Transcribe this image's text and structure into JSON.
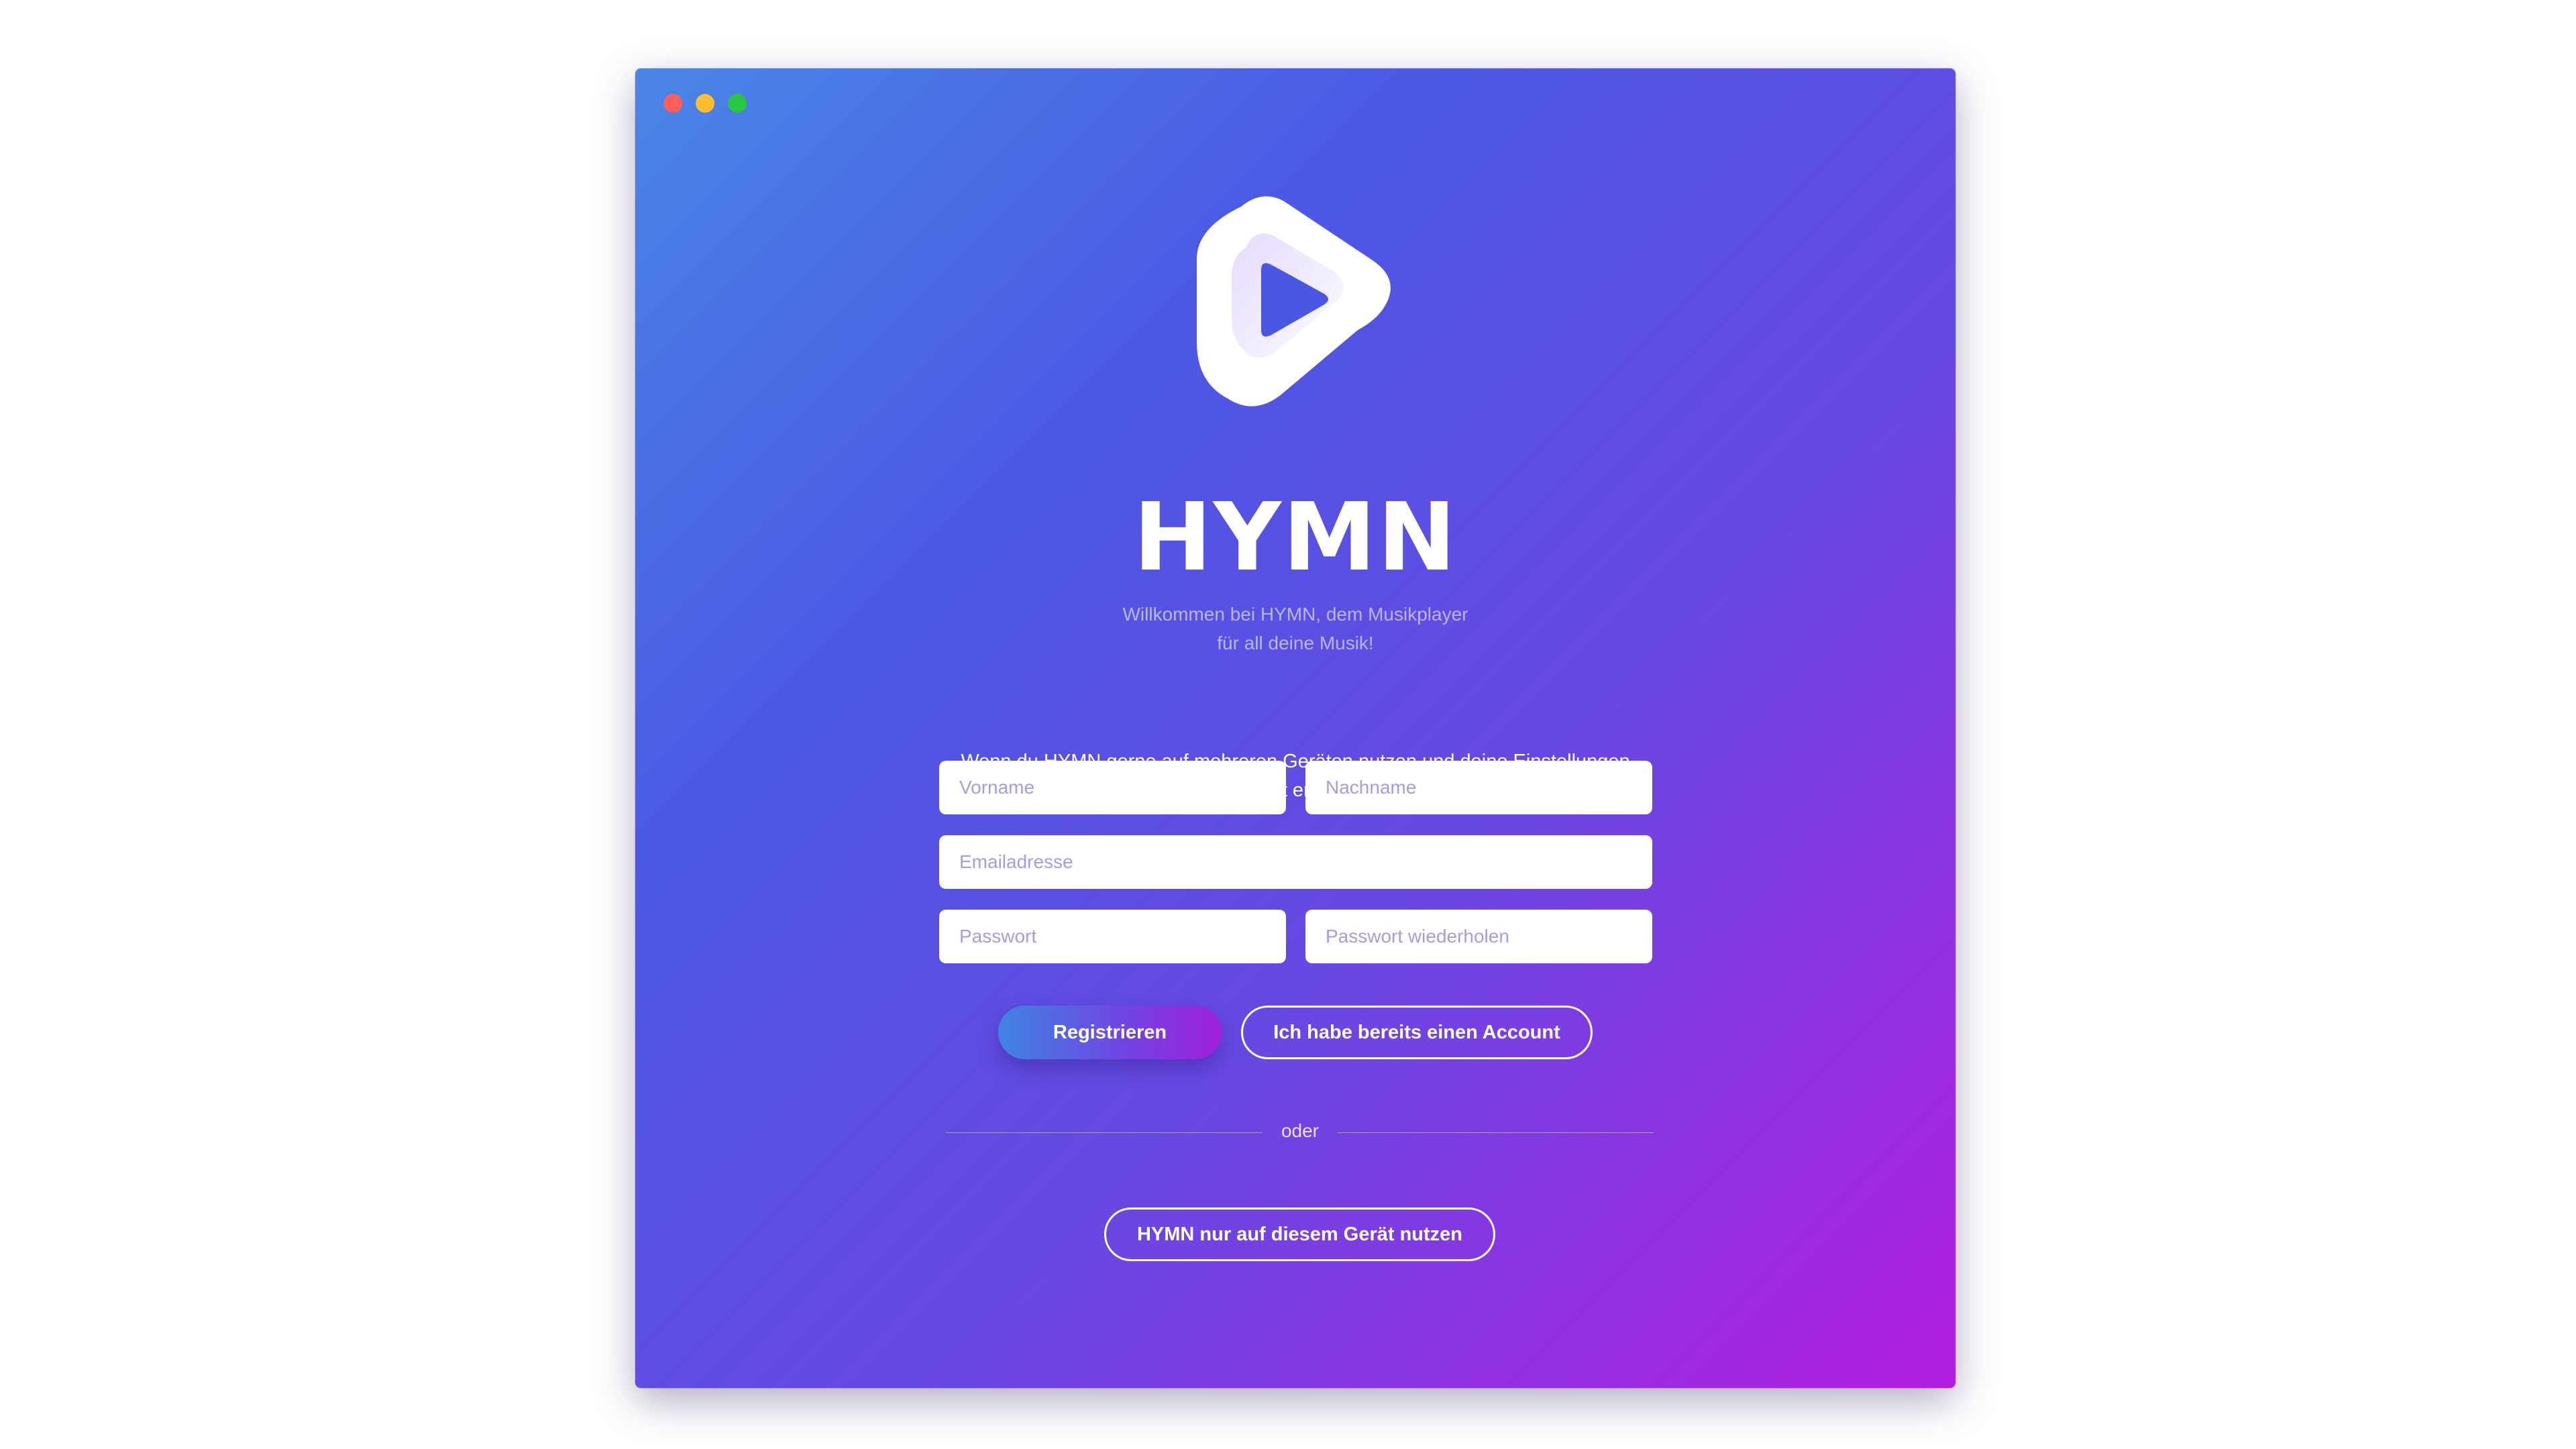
{
  "window": {
    "controls": [
      "close",
      "minimize",
      "zoom"
    ]
  },
  "brand": {
    "logo_icon": "play-triangle-icon",
    "name": "HYMN",
    "tagline_line1": "Willkommen bei HYMN, dem Musikplayer",
    "tagline_line2": "für all deine Musik!"
  },
  "intro": {
    "line1": "Wenn du HYMN gerne auf mehreren Geräten nutzen und deine Einstellungen",
    "line2": "synchronisieren möchtest erstelle jetzt einen Account"
  },
  "form": {
    "first_name_placeholder": "Vorname",
    "last_name_placeholder": "Nachname",
    "email_placeholder": "Emailadresse",
    "password_placeholder": "Passwort",
    "password_repeat_placeholder": "Passwort wiederholen"
  },
  "actions": {
    "register_label": "Registrieren",
    "login_label": "Ich habe bereits einen Account",
    "divider_label": "oder",
    "local_label": "HYMN nur auf diesem Gerät nutzen"
  },
  "colors": {
    "gradient_start": "#4a86e6",
    "gradient_mid": "#4b59e4",
    "gradient_end": "#b31ee0",
    "close": "#fe5f57",
    "minimize": "#febc2e",
    "zoom": "#28c840"
  }
}
